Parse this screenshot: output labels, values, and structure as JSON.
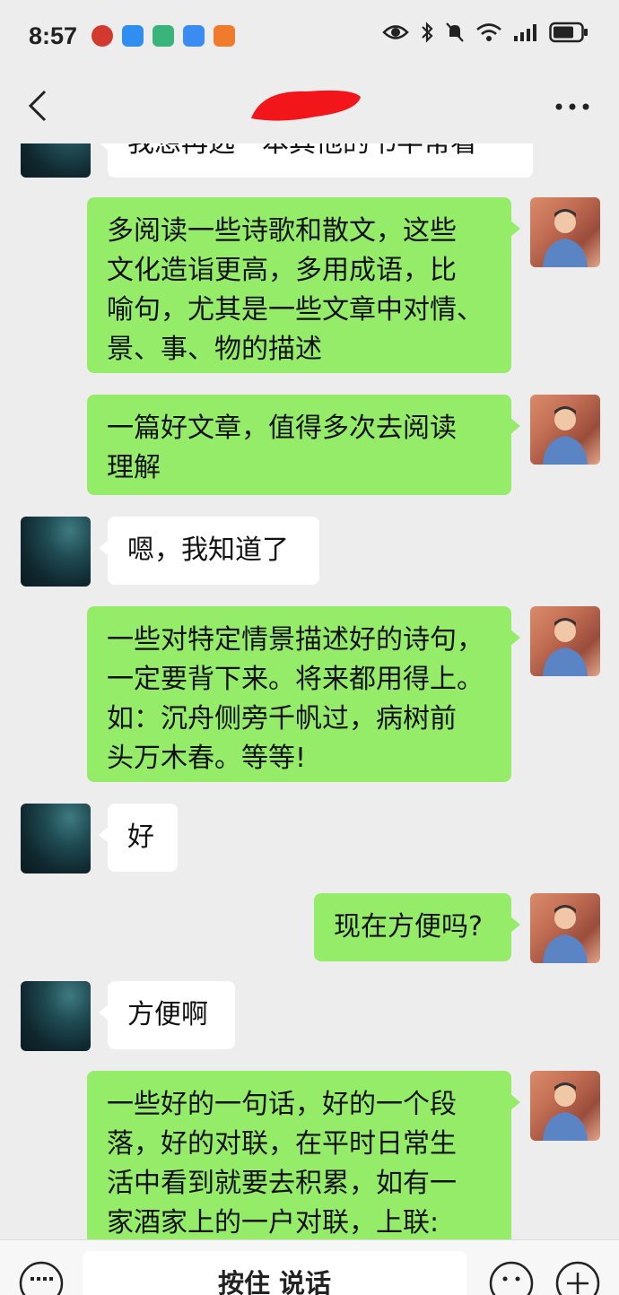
{
  "status_bar": {
    "time": "8:57",
    "app_icons": [
      "bank-app-icon",
      "message-app-icon",
      "wallet-app-icon",
      "cloud-app-icon",
      "delivery-app-icon"
    ],
    "system_icons": [
      "eye-icon",
      "bluetooth-icon",
      "mute-icon",
      "wifi-icon",
      "signal-icon",
      "battery-icon"
    ]
  },
  "header": {
    "contact_name_redacted": true
  },
  "messages": [
    {
      "from": "them",
      "text": "我想再选一本其他的书半常看"
    },
    {
      "from": "me",
      "lines": [
        "多阅读一些诗歌和散文，这些",
        "文化造诣更高，多用成语，比",
        "喻句，尤其是一些文章中对情、",
        "景、事、物的描述"
      ]
    },
    {
      "from": "me",
      "lines": [
        "一篇好文章，值得多次去阅读",
        "理解"
      ]
    },
    {
      "from": "them",
      "text": "嗯，我知道了"
    },
    {
      "from": "me",
      "lines": [
        "一些对特定情景描述好的诗句，",
        "一定要背下来。将来都用得上。",
        "如：沉舟侧旁千帆过，病树前",
        "头万木春。等等!"
      ]
    },
    {
      "from": "them",
      "text": "好"
    },
    {
      "from": "me",
      "text": "现在方便吗?"
    },
    {
      "from": "them",
      "text": "方便啊"
    },
    {
      "from": "me",
      "lines": [
        "一些好的一句话，好的一个段",
        "落，好的对联，在平时日常生",
        "活中看到就要去积累，如有一",
        "家酒家上的一户对联，上联:"
      ]
    }
  ],
  "input_bar": {
    "hold_to_talk_label": "按住 说话"
  },
  "colors": {
    "my_bubble": "#95ec69",
    "their_bubble": "#ffffff",
    "background": "#ededed"
  }
}
